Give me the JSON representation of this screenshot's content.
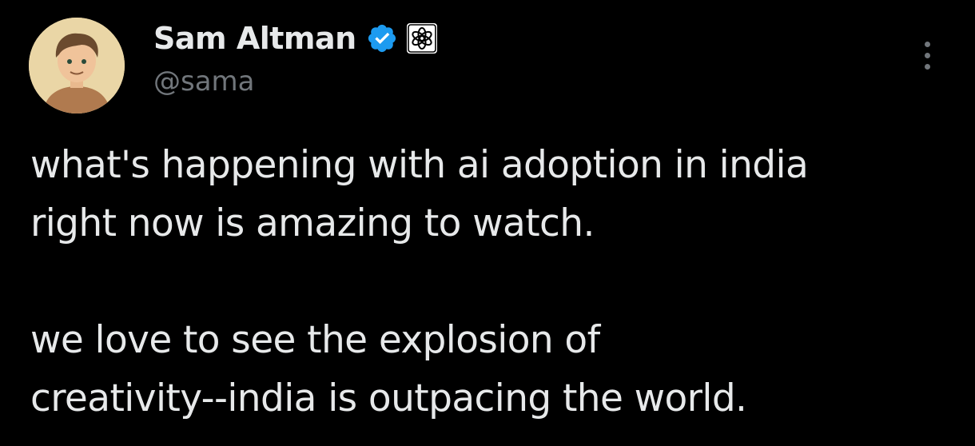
{
  "author": {
    "display_name": "Sam Altman",
    "handle": "@sama",
    "verified_icon": "verified-badge-icon",
    "affiliate_icon": "openai-logo-icon",
    "avatar_icon": "avatar-illustration"
  },
  "menu": {
    "icon": "more-options-icon"
  },
  "tweet": {
    "paragraphs": [
      {
        "lines": [
          "what's happening with ai adoption in india",
          "right now is amazing to watch."
        ]
      },
      {
        "lines": [
          "we love to see the explosion of",
          "creativity--india is outpacing the world."
        ]
      }
    ]
  },
  "colors": {
    "background": "#000000",
    "primary_text": "#e7e9ea",
    "secondary_text": "#71767b",
    "verified_blue": "#1d9bf0"
  }
}
